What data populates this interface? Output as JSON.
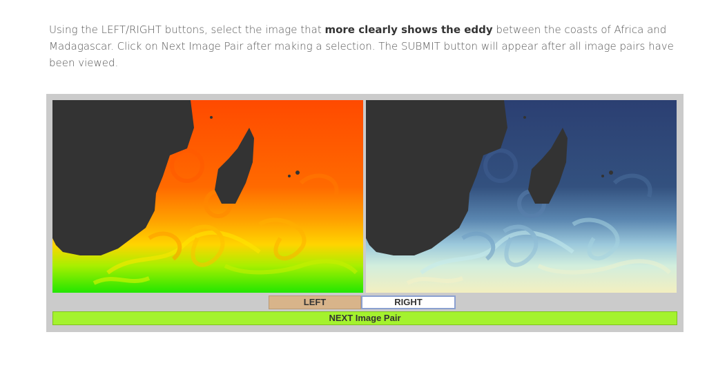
{
  "instructions": {
    "part1": "Using the LEFT/RIGHT buttons, select the image that ",
    "emphasis": "more clearly shows the eddy",
    "part2": " between the coasts of Africa and Madagascar. Click on Next Image Pair after making a selection. The SUBMIT button will appear after all image pairs have been viewed."
  },
  "images": {
    "left": {
      "colormap": "green-yellow-red",
      "colors": [
        "#22e600",
        "#c8f000",
        "#ffd400",
        "#ff8a00",
        "#ff4a00"
      ]
    },
    "right": {
      "colormap": "cream-cyan-navy",
      "colors": [
        "#f3efc0",
        "#c6ecee",
        "#6f9ec4",
        "#3a5a8a",
        "#2b3f72"
      ]
    },
    "land_color": "#333333"
  },
  "buttons": {
    "left_label": "LEFT",
    "right_label": "RIGHT",
    "next_label": "NEXT Image Pair"
  },
  "colors": {
    "panel_bg": "#cbcbcb",
    "left_button_bg": "#d8b48a",
    "right_button_bg": "#ffffff",
    "next_button_bg": "#a4f22e"
  }
}
